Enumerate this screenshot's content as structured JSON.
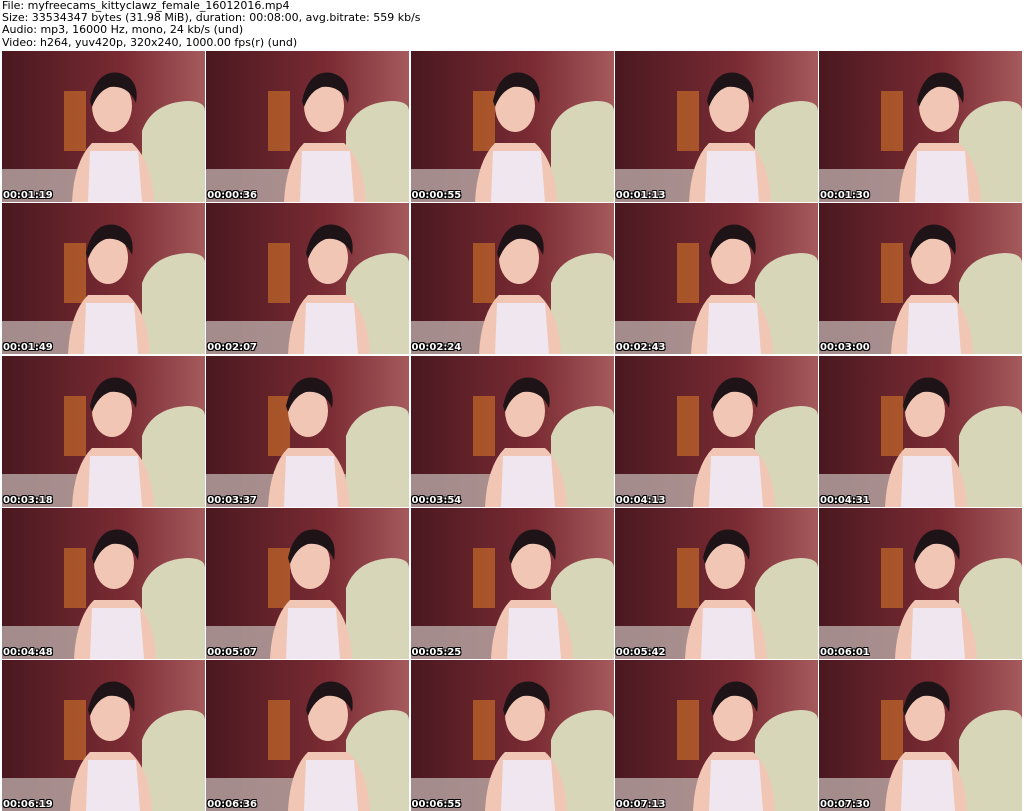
{
  "header": {
    "file_line": "File: myfreecams_kittyclawz_female_16012016.mp4",
    "size_line": "Size: 33534347 bytes (31.98 MiB), duration: 00:08:00, avg.bitrate: 559 kb/s",
    "audio_line": "Audio: mp3, 16000 Hz, mono, 24 kb/s (und)",
    "video_line": "Video: h264, yuv420p, 320x240, 1000.00 fps(r) (und)"
  },
  "thumbnails": [
    {
      "time": "00:01:19"
    },
    {
      "time": "00:00:36"
    },
    {
      "time": "00:00:55"
    },
    {
      "time": "00:01:13"
    },
    {
      "time": "00:01:30"
    },
    {
      "time": "00:01:49"
    },
    {
      "time": "00:02:07"
    },
    {
      "time": "00:02:24"
    },
    {
      "time": "00:02:43"
    },
    {
      "time": "00:03:00"
    },
    {
      "time": "00:03:18"
    },
    {
      "time": "00:03:37"
    },
    {
      "time": "00:03:54"
    },
    {
      "time": "00:04:13"
    },
    {
      "time": "00:04:31"
    },
    {
      "time": "00:04:48"
    },
    {
      "time": "00:05:07"
    },
    {
      "time": "00:05:25"
    },
    {
      "time": "00:05:42"
    },
    {
      "time": "00:06:01"
    },
    {
      "time": "00:06:19"
    },
    {
      "time": "00:06:36"
    },
    {
      "time": "00:06:55"
    },
    {
      "time": "00:07:13"
    },
    {
      "time": "00:07:30"
    }
  ],
  "colors": {
    "wall": "#7a2b33",
    "wall_dark": "#4a1820",
    "chair": "#d8d6b8",
    "skin": "#f2c6b4",
    "hair": "#1e1418",
    "top": "#efe6f0"
  }
}
